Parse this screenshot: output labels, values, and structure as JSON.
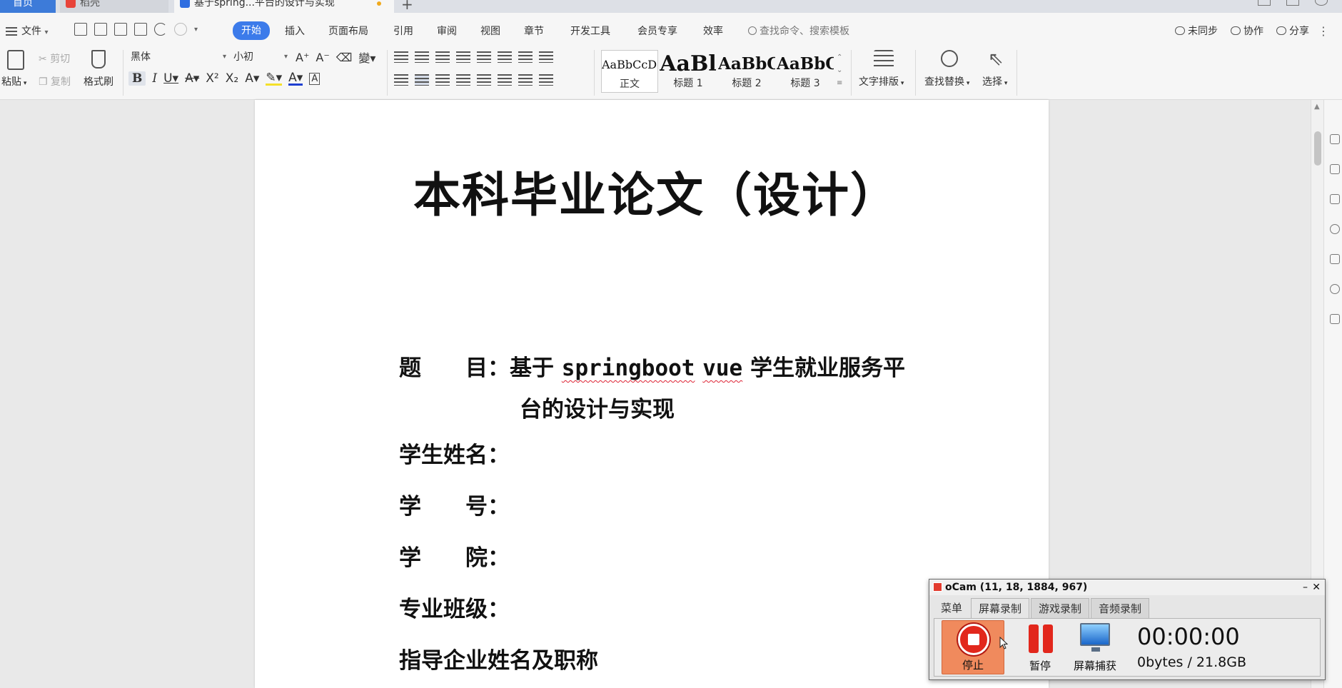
{
  "tabs": {
    "home": "首页",
    "daoke": "稻壳",
    "doc": "基于spring...平台的设计与实现"
  },
  "menu": {
    "file": "文件",
    "items": [
      "开始",
      "插入",
      "页面布局",
      "引用",
      "审阅",
      "视图",
      "章节",
      "开发工具",
      "会员专享",
      "效率"
    ],
    "active": "开始",
    "search_placeholder": "查找命令、搜索模板",
    "unsync": "未同步",
    "collab": "协作",
    "share": "分享"
  },
  "ribbon": {
    "paste": "粘贴",
    "cut": "剪切",
    "copy": "复制",
    "format_painter": "格式刷",
    "font_name": "黑体",
    "font_size": "小初",
    "styles": [
      {
        "sample": "AaBbCcDd",
        "name": "正文"
      },
      {
        "sample": "AaBl",
        "name": "标题 1"
      },
      {
        "sample": "AaBbC",
        "name": "标题 2"
      },
      {
        "sample": "AaBbC",
        "name": "标题 3"
      }
    ],
    "text_layout": "文字排版",
    "find_replace": "查找替换",
    "select": "选择"
  },
  "document": {
    "title": "本科毕业论文（设计）",
    "fields": [
      {
        "label": "题　　目：",
        "value_prefix": "基于 ",
        "value_code1": "springboot",
        "value_space": " ",
        "value_code2": "vue",
        "value_suffix": " 学生就业服务平",
        "continuation": "台的设计与实现"
      },
      {
        "label": "学生姓名："
      },
      {
        "label": "学　　号："
      },
      {
        "label": "学　　院："
      },
      {
        "label": "专业班级："
      },
      {
        "label": "指导企业姓名及职称"
      }
    ]
  },
  "ocam": {
    "title": "oCam (11, 18, 1884, 967)",
    "tabs": [
      "菜单",
      "屏幕录制",
      "游戏录制",
      "音频录制"
    ],
    "stop": "停止",
    "pause": "暂停",
    "capture": "屏幕捕获",
    "timer": "00:00:00",
    "size": "0bytes / 21.8GB"
  }
}
